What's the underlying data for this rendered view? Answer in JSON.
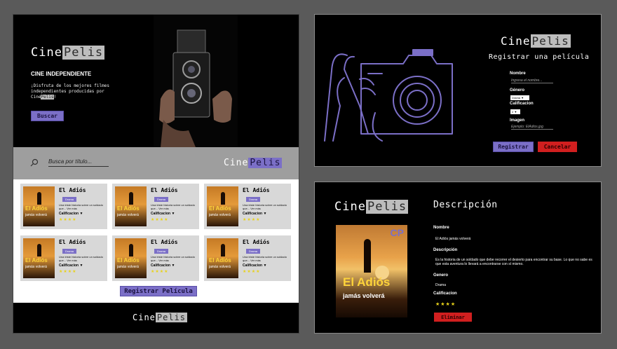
{
  "brand": {
    "prefix": "Cine",
    "suffix": "Pelis"
  },
  "home": {
    "tagline": "CINE INDEPENDIENTE",
    "description_a": "¡Disfruta de los mejores filmes independientes producidas por Cine",
    "description_hl": "Pelis",
    "description_b": "!",
    "search_button": "Buscar",
    "search_placeholder": "Busca por título...",
    "register_button": "Registrar Película",
    "movies": [
      {
        "title": "El Adiós",
        "genre": "Drama",
        "desc": "Una triste historia sobre un soldado que... Ver más",
        "rating_label": "Calificacion ▼",
        "stars": "★★★★",
        "poster_title": "El Adiós",
        "poster_sub": "jamás volverá"
      },
      {
        "title": "El Adiós",
        "genre": "Drama",
        "desc": "Una triste historia sobre un soldado que... Ver más",
        "rating_label": "Calificacion ▼",
        "stars": "★★★★",
        "poster_title": "El Adiós",
        "poster_sub": "jamás volverá"
      },
      {
        "title": "El Adiós",
        "genre": "Drama",
        "desc": "Una triste historia sobre un soldado que... Ver más",
        "rating_label": "Calificacion ▼",
        "stars": "★★★★",
        "poster_title": "El Adiós",
        "poster_sub": "jamás volverá"
      },
      {
        "title": "El Adiós",
        "genre": "Drama",
        "desc": "Una triste historia sobre un soldado que... Ver más",
        "rating_label": "Calificacion ▼",
        "stars": "★★★★",
        "poster_title": "El Adiós",
        "poster_sub": "jamás volverá"
      },
      {
        "title": "El Adiós",
        "genre": "Drama",
        "desc": "Una triste historia sobre un soldado que... Ver más",
        "rating_label": "Calificacion ▼",
        "stars": "★★★★",
        "poster_title": "El Adiós",
        "poster_sub": "jamás volverá"
      },
      {
        "title": "El Adiós",
        "genre": "Drama",
        "desc": "Una triste historia sobre un soldado que... Ver más",
        "rating_label": "Calificacion ▼",
        "stars": "★★★★",
        "poster_title": "El Adiós",
        "poster_sub": "jamás volverá"
      }
    ]
  },
  "register": {
    "title": "Registrar una película",
    "name_label": "Nombre",
    "name_placeholder": "Ingresa el nombre...",
    "genre_label": "Género",
    "genre_value": "Drama ▼",
    "rating_label": "Calificacion",
    "rating_value": "2 ▼",
    "image_label": "Imagen",
    "image_placeholder": "Ejemplo: ElAdios.jpg",
    "submit": "Registrar",
    "cancel": "Cancelar"
  },
  "detail": {
    "title": "Descripción",
    "poster_brand": "CP",
    "poster_title": "El Adiós",
    "poster_sub": "jamás volverá",
    "name_label": "Nombre",
    "name_value": "El Adiós jamás volverá",
    "desc_label": "Descripción",
    "desc_value": "Es la historia de un soldado que debe recorrer el desierto para encontrar su base. Lo que no sabe es que esta aventura lo llevará a encontrarse con sí mismo.",
    "genre_label": "Genero",
    "genre_value": "Drama",
    "rating_label": "Calificacion",
    "stars": "★★★★",
    "delete": "Eliminar"
  },
  "colors": {
    "accent": "#7b6fc7",
    "danger": "#d11f1f",
    "star": "#e8d21a"
  }
}
